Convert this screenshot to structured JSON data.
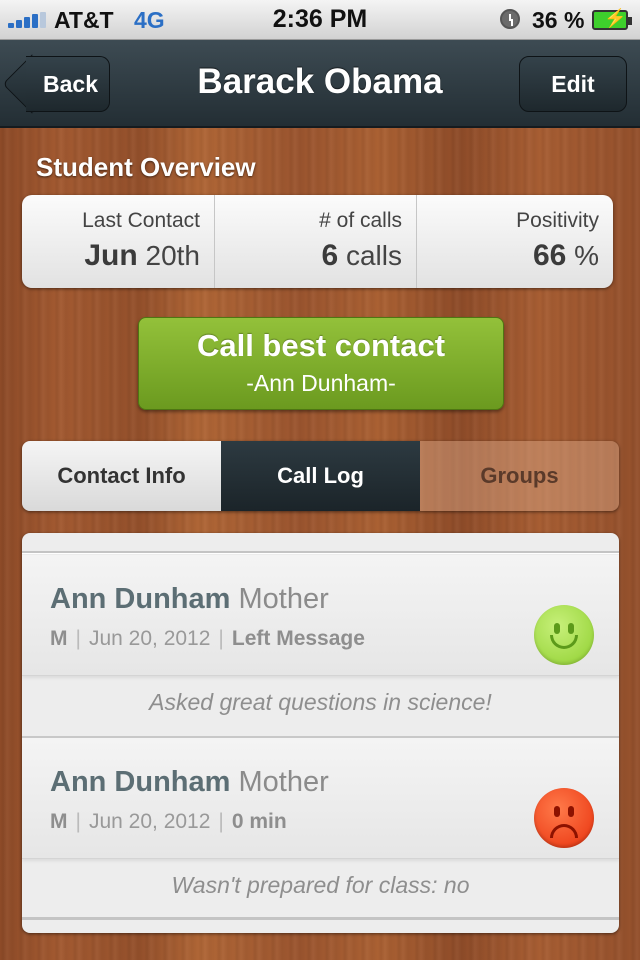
{
  "status_bar": {
    "carrier": "AT&T",
    "network": "4G",
    "time": "2:36 PM",
    "battery": "36 %",
    "icons": [
      "signal-icon",
      "alarm-icon",
      "battery-icon"
    ],
    "accent": "#2b6fc5"
  },
  "nav": {
    "back_label": "Back",
    "title": "Barack Obama",
    "edit_label": "Edit"
  },
  "overview": {
    "title": "Student Overview",
    "stats": [
      {
        "label": "Last Contact",
        "value_bold": "Jun",
        "value_rest": " 20th"
      },
      {
        "label": "# of calls",
        "value_bold": "6",
        "value_rest": " calls"
      },
      {
        "label": "Positivity",
        "value_bold": "66",
        "value_rest": " %"
      }
    ]
  },
  "call_button": {
    "title": "Call best contact",
    "subtitle": "-Ann Dunham-",
    "color": "#7eab2b"
  },
  "tabs": [
    {
      "label": "Contact Info",
      "selected": false
    },
    {
      "label": "Call Log",
      "selected": true
    },
    {
      "label": "Groups",
      "selected": false
    }
  ],
  "call_log": [
    {
      "name": "Ann Dunham",
      "relation": " Mother",
      "initial": "M",
      "date": "Jun 20, 2012",
      "result": "Left Message",
      "mood": "happy-face-icon",
      "mood_color": "#9fdc3a",
      "note": "Asked great questions in science!"
    },
    {
      "name": "Ann Dunham",
      "relation": " Mother",
      "initial": "M",
      "date": "Jun 20, 2012",
      "result": "0 min",
      "mood": "sad-face-icon",
      "mood_color": "#f2451a",
      "note": "Wasn't prepared for class: no"
    }
  ]
}
